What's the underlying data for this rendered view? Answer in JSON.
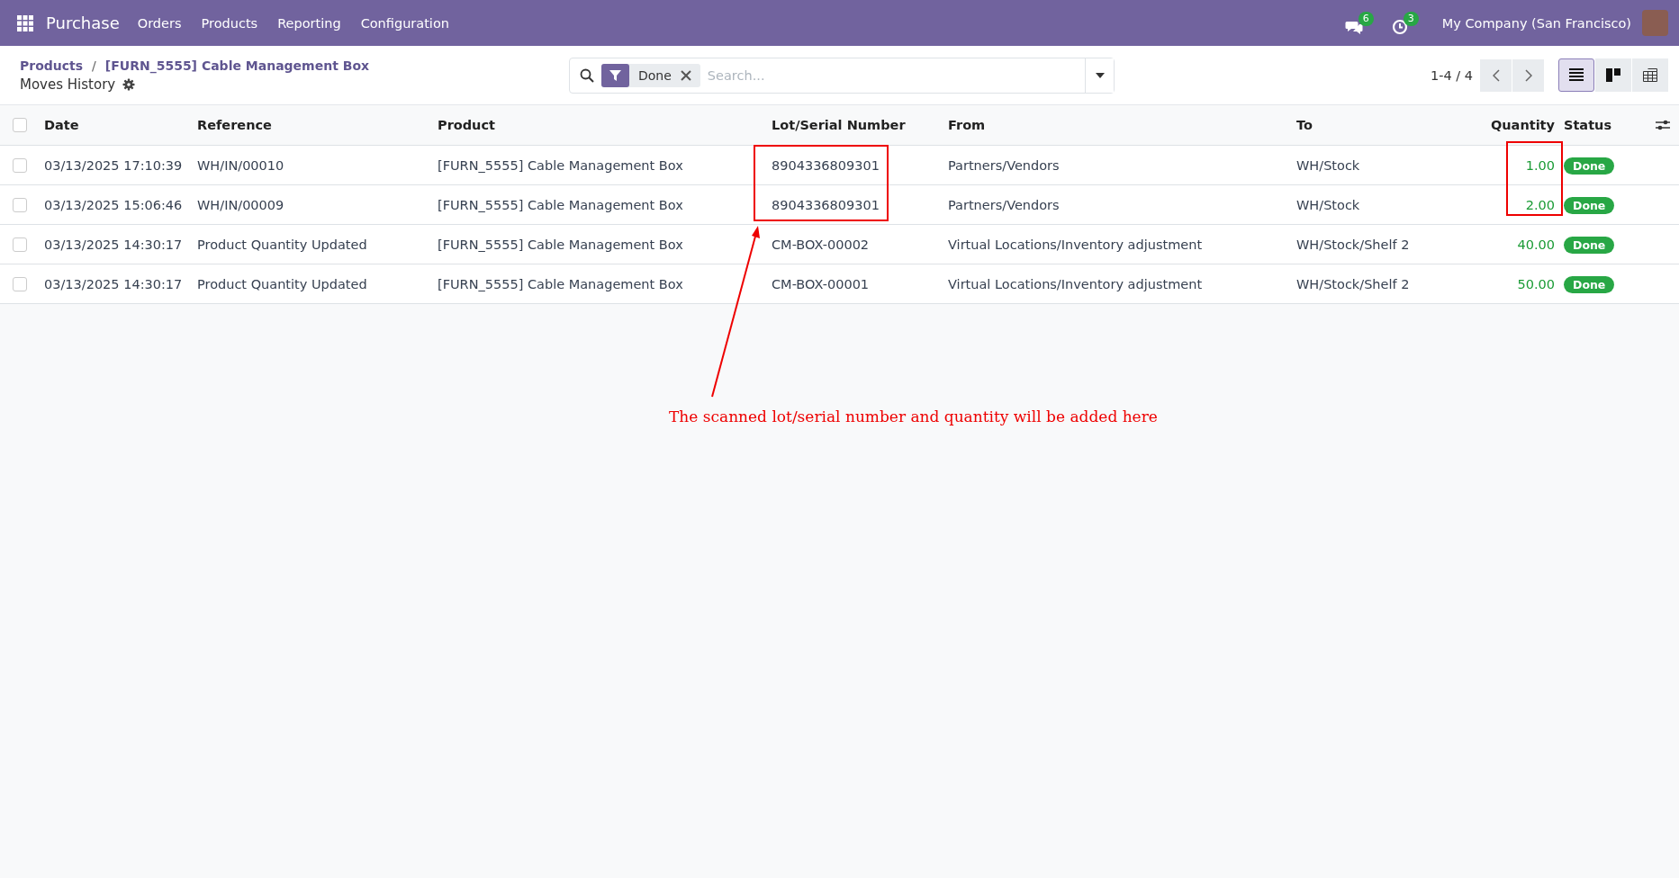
{
  "navbar": {
    "app": "Purchase",
    "menu": [
      "Orders",
      "Products",
      "Reporting",
      "Configuration"
    ],
    "messages_count": "6",
    "activities_count": "3",
    "company": "My Company (San Francisco)"
  },
  "breadcrumb": [
    "Products",
    "[FURN_5555] Cable Management Box"
  ],
  "breadcrumb_separator": "/",
  "page_title": "Moves History",
  "search": {
    "facet": "Done",
    "placeholder": "Search..."
  },
  "pager": "1-4 / 4",
  "views": [
    {
      "kind": "list",
      "selected": true
    },
    {
      "kind": "kanban",
      "selected": false
    },
    {
      "kind": "pivot",
      "selected": false
    }
  ],
  "table": {
    "select_all": {
      "checked": false
    },
    "columns": [
      "Date",
      "Reference",
      "Product",
      "Lot/Serial Number",
      "From",
      "To",
      "Quantity",
      "Status"
    ],
    "rows": [
      {
        "selected": false,
        "cells": [
          "03/13/2025 17:10:39",
          "WH/IN/00010",
          "[FURN_5555] Cable Management Box",
          "8904336809301",
          "Partners/Vendors",
          "WH/Stock",
          "1.00"
        ],
        "status": "Done"
      },
      {
        "selected": false,
        "cells": [
          "03/13/2025 15:06:46",
          "WH/IN/00009",
          "[FURN_5555] Cable Management Box",
          "8904336809301",
          "Partners/Vendors",
          "WH/Stock",
          "2.00"
        ],
        "status": "Done"
      },
      {
        "selected": false,
        "cells": [
          "03/13/2025 14:30:17",
          "Product Quantity Updated",
          "[FURN_5555] Cable Management Box",
          "CM-BOX-00002",
          "Virtual Locations/Inventory adjustment",
          "WH/Stock/Shelf 2",
          "40.00"
        ],
        "status": "Done"
      },
      {
        "selected": false,
        "cells": [
          "03/13/2025 14:30:17",
          "Product Quantity Updated",
          "[FURN_5555] Cable Management Box",
          "CM-BOX-00001",
          "Virtual Locations/Inventory adjustment",
          "WH/Stock/Shelf 2",
          "50.00"
        ],
        "status": "Done"
      }
    ]
  },
  "annotation": {
    "text": "The scanned lot/serial number and quantity will be added here"
  }
}
